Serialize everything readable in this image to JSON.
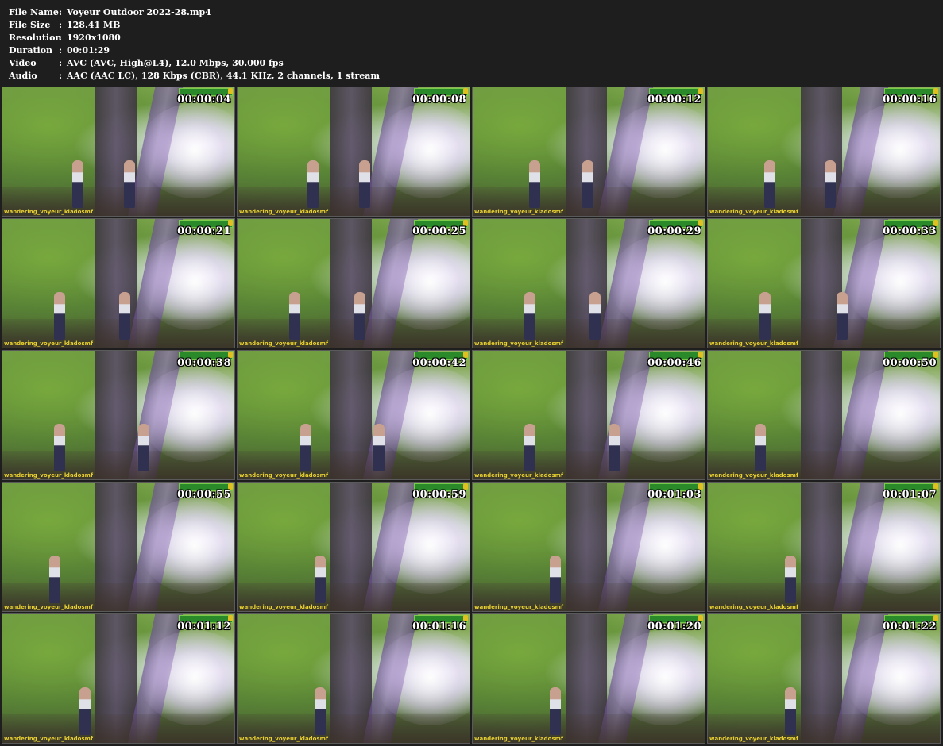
{
  "info": [
    {
      "label": "File Name",
      "value": "Voyeur Outdoor 2022-28.mp4"
    },
    {
      "label": "File Size",
      "value": "128.41 MB"
    },
    {
      "label": "Resolution",
      "value": "1920x1080"
    },
    {
      "label": "Duration",
      "value": "00:01:29"
    },
    {
      "label": "Video",
      "value": "AVC (AVC, High@L4), 12.0 Mbps, 30.000 fps"
    },
    {
      "label": "Audio",
      "value": "AAC (AAC LC), 128 Kbps (CBR), 44.1 KHz, 2 channels, 1 stream"
    }
  ],
  "colon": ":",
  "watermark": "wandering_voyeur_kladosmf",
  "thumbnails": [
    "00:00:04",
    "00:00:08",
    "00:00:12",
    "00:00:16",
    "00:00:21",
    "00:00:25",
    "00:00:29",
    "00:00:33",
    "00:00:38",
    "00:00:42",
    "00:00:46",
    "00:00:50",
    "00:00:55",
    "00:00:59",
    "00:01:03",
    "00:01:07",
    "00:01:12",
    "00:01:16",
    "00:01:20",
    "00:01:22"
  ]
}
